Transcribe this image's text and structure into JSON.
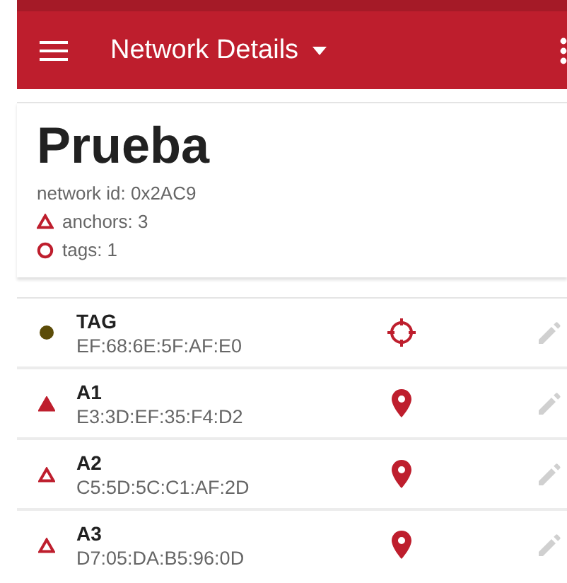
{
  "app_bar": {
    "title": "Network Details"
  },
  "network": {
    "name": "Prueba",
    "id_line": "network id: 0x2AC9",
    "anchors": "anchors: 3",
    "tags": "tags: 1"
  },
  "nodes": [
    {
      "kind": "tag",
      "name": "TAG",
      "address": "EF:68:6E:5F:AF:E0",
      "color": "#5c4c08"
    },
    {
      "kind": "anchor",
      "name": "A1",
      "address": "E3:3D:EF:35:F4:D2",
      "filled": true
    },
    {
      "kind": "anchor",
      "name": "A2",
      "address": "C5:5D:5C:C1:AF:2D",
      "filled": false
    },
    {
      "kind": "anchor",
      "name": "A3",
      "address": "D7:05:DA:B5:96:0D",
      "filled": false
    }
  ]
}
